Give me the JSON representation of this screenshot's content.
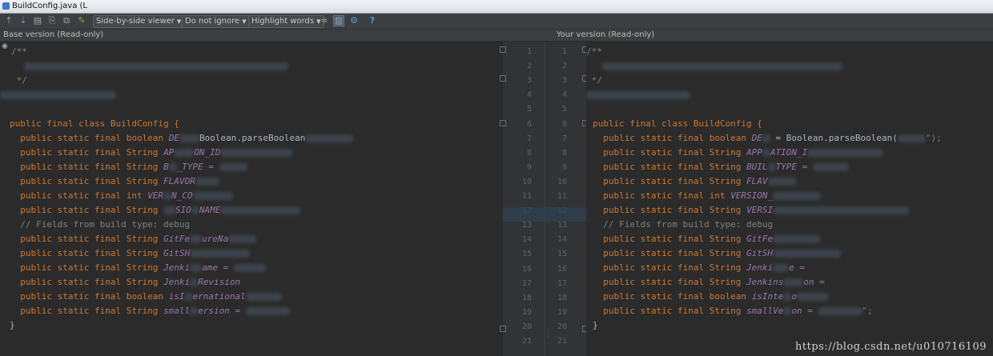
{
  "window": {
    "title": "BuildConfig.java (L"
  },
  "toolbar": {
    "icons": [
      "up-arrow-icon",
      "down-arrow-icon",
      "save-icon",
      "apply-icon",
      "merge-icon",
      "edit-icon"
    ],
    "viewer_dropdown": "Side-by-side viewer",
    "ignore_dropdown": "Do not ignore",
    "highlight_dropdown": "Highlight words",
    "help_label": "?"
  },
  "headers": {
    "left": "Base version (Read-only)",
    "right": "Your version (Read-only)"
  },
  "gutter": {
    "left_numbers": [
      "1",
      "2",
      "3",
      "4",
      "5",
      "6",
      "7",
      "8",
      "9",
      "10",
      "11",
      "12",
      "13",
      "14",
      "15",
      "16",
      "17",
      "18",
      "19",
      "20",
      "21"
    ],
    "right_numbers": [
      "1",
      "2",
      "3",
      "4",
      "5",
      "8",
      "7",
      "8",
      "9",
      "10",
      "11",
      "12",
      "13",
      "14",
      "15",
      "16",
      "17",
      "18",
      "19",
      "20",
      "21"
    ]
  },
  "left_code": {
    "l1": "/**",
    "l3": " */",
    "class_decl": "public final class BuildConfig {",
    "debug_kw": "  public static final boolean ",
    "debug_name": "DE",
    "debug_rest": "Boolean.parseBoolean",
    "app_kw": "  public static final String ",
    "app_name": "AP",
    "app_name2": "ON_ID",
    "bt_kw": "  public static final String ",
    "bt_name": "B",
    "bt_name2": "_TYPE = ",
    "fl_kw": "  public static final String ",
    "fl_name": "FLAVOR",
    "vc_kw": "  public static final int ",
    "vc_name": "VER",
    "vc_name2": "N_CO",
    "vn_kw": "  public static final String ",
    "vn_name": "SIO",
    "vn_name2": "NAME",
    "fields_comment": "  // Fields from build type: debug",
    "gf_kw": "  public static final String ",
    "gf_name": "GitFe",
    "gf_name2": "ureNa",
    "gs_kw": "  public static final String ",
    "gs_name": "GitSH",
    "jn_kw": "  public static final String ",
    "jn_name": "Jenki",
    "jn_name2": "ame = ",
    "jr_kw": "  public static final String ",
    "jr_name": "Jenki",
    "jr_name2": "Revision",
    "ii_kw": "  public static final boolean ",
    "ii_name": "isI",
    "ii_name2": "ernational",
    "sv_kw": "  public static final String ",
    "sv_name": "small",
    "sv_name2": "ersion = ",
    "close": "}"
  },
  "right_code": {
    "l1": "/**",
    "l3": " */",
    "class_decl": "public final class BuildConfig {",
    "debug_kw": "  public static final boolean ",
    "debug_name": "DE",
    "debug_rest": " = Boolean.parseBoolean(",
    "debug_end": "\");",
    "app_kw": "  public static final String ",
    "app_name": "APP",
    "app_name2": "ATION_I",
    "bt_kw": "  public static final String ",
    "bt_name": "BUIL",
    "bt_name2": "TYPE = ",
    "fl_kw": "  public static final String ",
    "fl_name": "FLAV",
    "vc_kw": "  public static final int ",
    "vc_name": "VERSION_",
    "vn_kw": "  public static final String ",
    "vn_name": "VERSI",
    "fields_comment": "  // Fields from build type: debug",
    "gf_kw": "  public static final String ",
    "gf_name": "GitFe",
    "gs_kw": "  public static final String ",
    "gs_name": "GitSH",
    "jn_kw": "  public static final String ",
    "jn_name": "Jenki",
    "jn_name2": "e =",
    "jr_kw": "  public static final String ",
    "jr_name": "Jenkins",
    "jr_name2": "on =",
    "ii_kw": "  public static final boolean ",
    "ii_name": "isInte",
    "ii_name2": "o",
    "sv_kw": "  public static final String ",
    "sv_name": "smallVe",
    "sv_name2": "on = ",
    "sv_end": "\";",
    "close": "}"
  },
  "watermark": "https://blog.csdn.net/u010716109"
}
